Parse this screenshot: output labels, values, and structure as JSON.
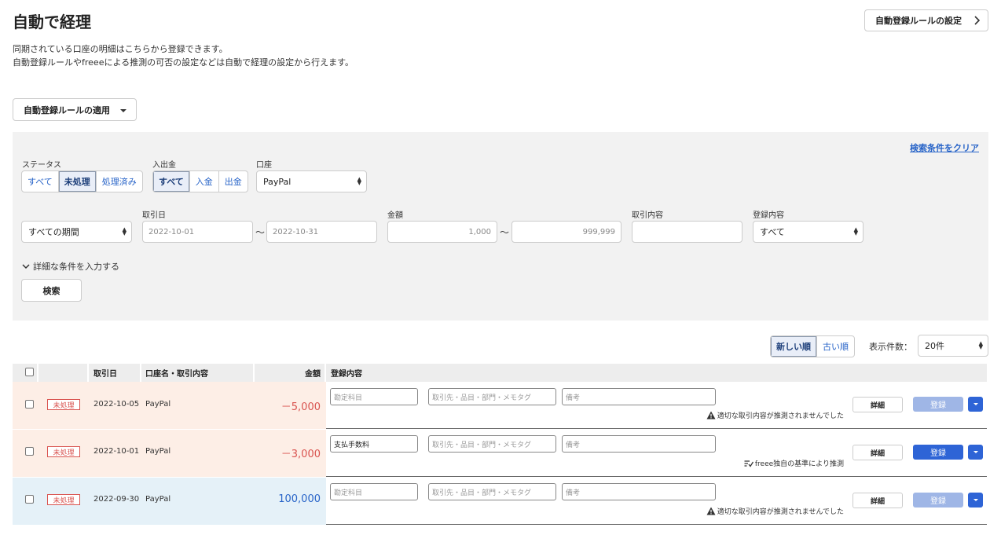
{
  "header": {
    "title": "自動で経理",
    "rule_settings_label": "自動登録ルールの設定",
    "desc_line1": "同期されている口座の明細はこちらから登録できます。",
    "desc_line2": "自動登録ルールやfreeeによる推測の可否の設定などは自動で経理の設定から行えます。"
  },
  "apply_rules_label": "自動登録ルールの適用",
  "filter": {
    "clear_label": "検索条件をクリア",
    "status": {
      "label": "ステータス",
      "options": [
        "すべて",
        "未処理",
        "処理済み"
      ],
      "selected": "未処理"
    },
    "direction": {
      "label": "入出金",
      "options": [
        "すべて",
        "入金",
        "出金"
      ],
      "selected": "すべて"
    },
    "account": {
      "label": "口座",
      "value": "PayPal"
    },
    "period": {
      "value": "すべての期間"
    },
    "date": {
      "label": "取引日",
      "from": "2022-10-01",
      "to": "2022-10-31"
    },
    "amount": {
      "label": "金額",
      "from": "1,000",
      "to": "999,999"
    },
    "content": {
      "label": "取引内容",
      "value": ""
    },
    "registration": {
      "label": "登録内容",
      "value": "すべて"
    },
    "tilde": "〜",
    "more_label": "詳細な条件を入力する",
    "search_label": "検索"
  },
  "list_controls": {
    "sort_options": [
      "新しい順",
      "古い順"
    ],
    "sort_selected": "新しい順",
    "per_page_label": "表示件数：",
    "per_page_value": "20件"
  },
  "table": {
    "headers": {
      "date": "取引日",
      "account": "口座名・取引内容",
      "amount": "金額",
      "registration": "登録内容"
    },
    "rows": [
      {
        "status": "未処理",
        "date": "2022-10-05",
        "account": "PayPal",
        "amount": "－5,000",
        "kind": "out",
        "account_item_value": "",
        "account_item_placeholder": "勘定科目",
        "partner_placeholder": "取引先・品目・部門・メモタグ",
        "memo_placeholder": "備考",
        "note_icon": "warning-icon",
        "note": "適切な取引内容が推測されませんでした",
        "detail_label": "詳細",
        "register_label": "登録",
        "register_enabled": false
      },
      {
        "status": "未処理",
        "date": "2022-10-01",
        "account": "PayPal",
        "amount": "－3,000",
        "kind": "out",
        "account_item_value": "支払手数料",
        "account_item_placeholder": "勘定科目",
        "partner_placeholder": "取引先・品目・部門・メモタグ",
        "memo_placeholder": "備考",
        "note_icon": "rule-check-icon",
        "note": "freee独自の基準により推測",
        "detail_label": "詳細",
        "register_label": "登録",
        "register_enabled": true
      },
      {
        "status": "未処理",
        "date": "2022-09-30",
        "account": "PayPal",
        "amount": "100,000",
        "kind": "in",
        "account_item_value": "",
        "account_item_placeholder": "勘定科目",
        "partner_placeholder": "取引先・品目・部門・メモタグ",
        "memo_placeholder": "備考",
        "note_icon": "warning-icon",
        "note": "適切な取引内容が推測されませんでした",
        "detail_label": "詳細",
        "register_label": "登録",
        "register_enabled": false
      }
    ]
  },
  "colors": {
    "accent": "#2864c8",
    "primary_button": "#2e64d6",
    "disabled_button": "#9fb6e6",
    "status_red": "#d9534f",
    "outflow_tint": "#fdeee6",
    "inflow_tint": "#e5f1f8"
  }
}
